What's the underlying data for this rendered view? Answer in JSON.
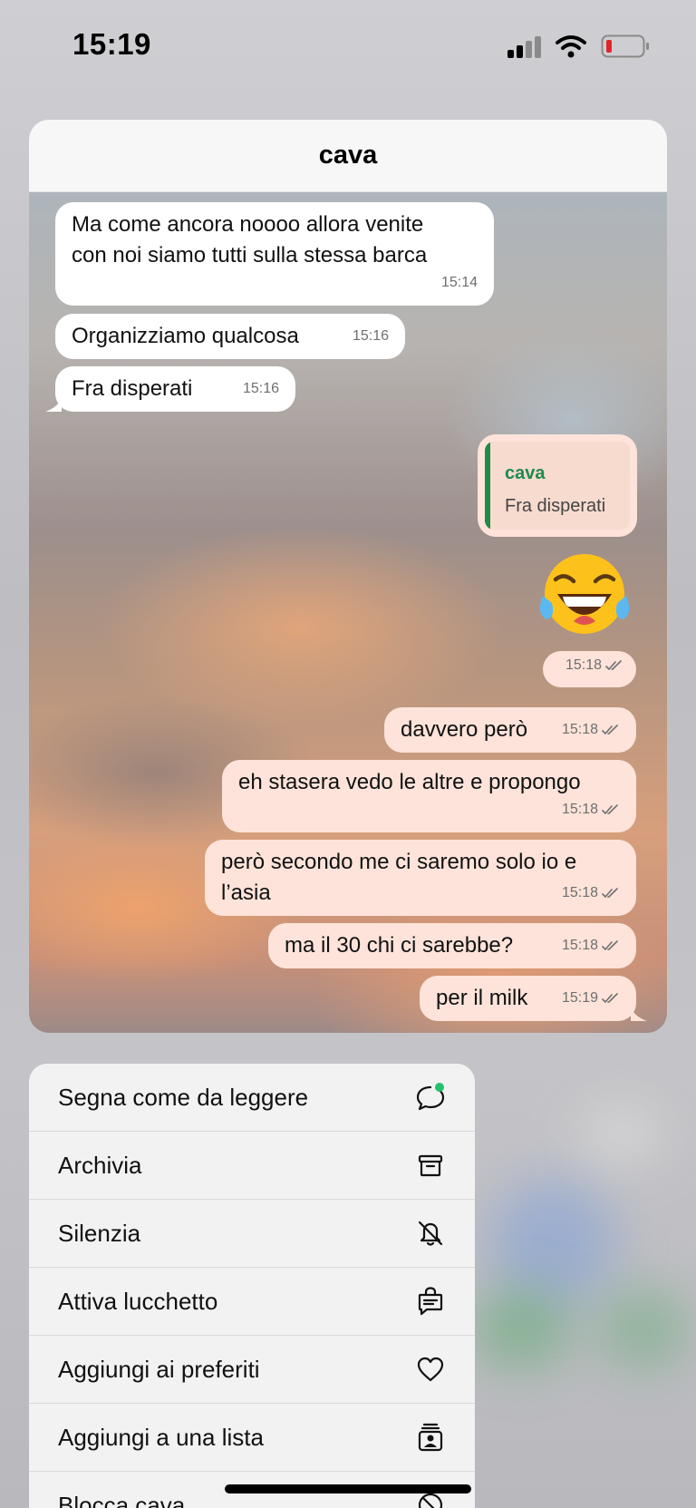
{
  "status_bar": {
    "time": "15:19"
  },
  "chat": {
    "title": "cava",
    "messages": [
      {
        "direction": "in",
        "lines": [
          "Ma come ancora noooo allora venite",
          "con noi siamo tutti sulla stessa barca"
        ],
        "time": "15:14"
      },
      {
        "direction": "in",
        "text": "Organizziamo qualcosa",
        "time": "15:16"
      },
      {
        "direction": "in",
        "text": "Fra disperati",
        "time": "15:16"
      },
      {
        "direction": "out",
        "reply_to": {
          "name": "cava",
          "text": "Fra disperati"
        }
      },
      {
        "direction": "out",
        "emoji": "😂",
        "time": "15:18"
      },
      {
        "direction": "out",
        "text": "davvero però",
        "time": "15:18"
      },
      {
        "direction": "out",
        "text": "eh stasera vedo le altre e propongo",
        "time": "15:18"
      },
      {
        "direction": "out",
        "lines": [
          "però secondo me ci saremo solo io e",
          "l’asia"
        ],
        "time": "15:18"
      },
      {
        "direction": "out",
        "text": "ma il 30 chi ci sarebbe?",
        "time": "15:18"
      },
      {
        "direction": "out",
        "text": "per il milk",
        "time": "15:19"
      }
    ]
  },
  "menu": {
    "items": [
      {
        "label": "Segna come da leggere",
        "icon": "chat-unread-icon"
      },
      {
        "label": "Archivia",
        "icon": "archive-icon"
      },
      {
        "label": "Silenzia",
        "icon": "bell-slash-icon"
      },
      {
        "label": "Attiva lucchetto",
        "icon": "chat-lock-icon"
      },
      {
        "label": "Aggiungi ai preferiti",
        "icon": "heart-icon"
      },
      {
        "label": "Aggiungi a una lista",
        "icon": "list-contact-icon"
      },
      {
        "label": "Blocca cava",
        "icon": "block-icon"
      }
    ]
  },
  "colors": {
    "incoming_bubble": "#ffffff",
    "outgoing_bubble": "#fde3d9",
    "reply_accent": "#1f8a4c",
    "unread_dot": "#25c26a",
    "battery_low": "#e0242a"
  }
}
